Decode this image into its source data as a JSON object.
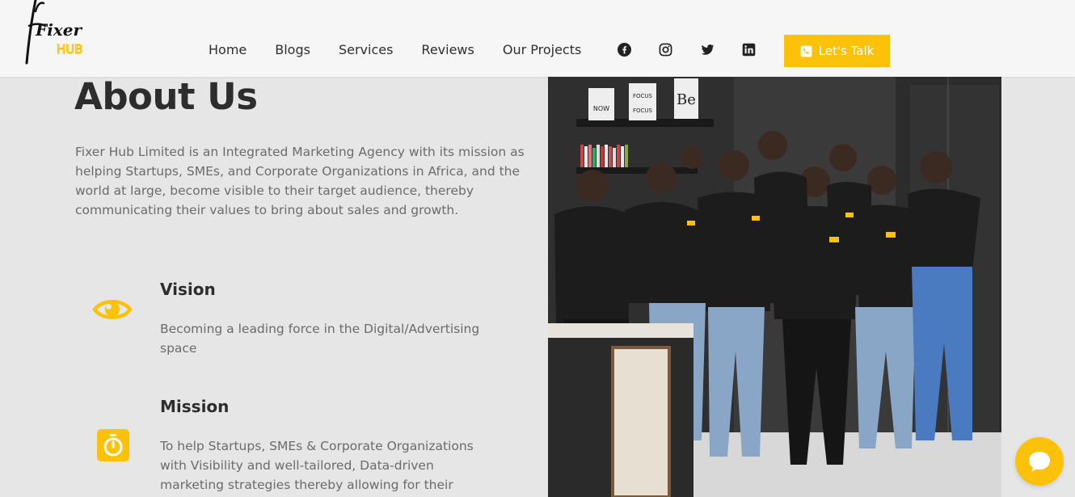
{
  "brand": {
    "logo_text_top": "Fixer",
    "logo_text_bottom": "HUB",
    "accent_color": "#fcc20a"
  },
  "nav": {
    "items": [
      {
        "label": "Home"
      },
      {
        "label": "Blogs"
      },
      {
        "label": "Services"
      },
      {
        "label": "Reviews"
      },
      {
        "label": "Our Projects"
      }
    ],
    "social": [
      "facebook-icon",
      "instagram-icon",
      "twitter-icon",
      "linkedin-icon"
    ],
    "cta_label": "Let's Talk",
    "cta_icon": "phone-icon"
  },
  "about": {
    "title": "About Us",
    "description": "Fixer Hub Limited is an Integrated Marketing Agency with its mission as helping Startups, SMEs, and Corporate Organizations in Africa, and the world at large, become visible to their target audience, thereby communicating their values to bring about sales and growth.",
    "features": [
      {
        "icon": "eye-icon",
        "title": "Vision",
        "text": "Becoming a leading force in the Digital/Advertising space"
      },
      {
        "icon": "stopwatch-icon",
        "title": "Mission",
        "text": "To help Startups, SMEs & Corporate Organizations with Visibility and well-tailored, Data-driven marketing strategies thereby allowing for their"
      }
    ]
  },
  "photo": {
    "shelf_signs": [
      "FOCUS",
      "NOW",
      "FOCUS",
      "Be"
    ]
  },
  "chat": {
    "icon": "chat-bubble-icon"
  }
}
